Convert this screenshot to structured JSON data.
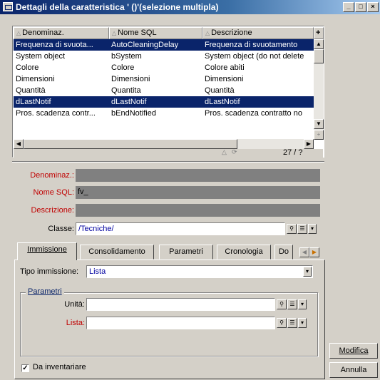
{
  "window": {
    "title": "Dettagli della caratteristica ' ()'(selezione multipla)",
    "controls": [
      "_",
      "□",
      "×"
    ]
  },
  "list": {
    "columns": [
      {
        "label": "Denominaz."
      },
      {
        "label": "Nome SQL"
      },
      {
        "label": "Descrizione"
      }
    ],
    "rows": [
      {
        "name": "Frequenza di svuota...",
        "sql": "AutoCleaningDelay",
        "desc": "Frequenza di svuotamento",
        "selected": true
      },
      {
        "name": "System object",
        "sql": "bSystem",
        "desc": "System object (do not delete",
        "selected": false
      },
      {
        "name": "Colore",
        "sql": "Colore",
        "desc": "Colore abiti",
        "selected": false
      },
      {
        "name": "Dimensioni",
        "sql": "Dimensioni",
        "desc": "Dimensioni",
        "selected": false
      },
      {
        "name": "Quantità",
        "sql": "Quantita",
        "desc": "Quantità",
        "selected": false
      },
      {
        "name": "dLastNotif",
        "sql": "dLastNotif",
        "desc": "dLastNotif",
        "selected": true
      },
      {
        "name": "Pros. scadenza contr...",
        "sql": "bEndNotified",
        "desc": "Pros. scadenza contratto no",
        "selected": false
      }
    ],
    "record_count": "27 / ?",
    "add_column_symbol": "+"
  },
  "form": {
    "denominaz_label": "Denominaz.:",
    "nome_sql_label": "Nome SQL:",
    "nome_sql_value": "fv_",
    "descrizione_label": "Descrizione:",
    "classe_label": "Classe:",
    "classe_value": "/Tecniche/"
  },
  "tabs": {
    "items": [
      {
        "label": "Immissione",
        "active": true
      },
      {
        "label": "Consolidamento",
        "active": false
      },
      {
        "label": "Parametri",
        "active": false
      },
      {
        "label": "Cronologia",
        "active": false
      },
      {
        "label": "Do",
        "active": false
      }
    ],
    "tipo_label": "Tipo immissione:",
    "tipo_value": "Lista",
    "group_title": "Parametri",
    "unita_label": "Unità:",
    "lista_label": "Lista:"
  },
  "footer": {
    "checkbox_label": "Da inventariare",
    "checkbox_checked": true,
    "modifica_label": "Modifica",
    "annulla_label": "Annulla"
  },
  "colors": {
    "selection": "#0a246a",
    "required_label": "#c00000",
    "face": "#d4d0c8"
  }
}
